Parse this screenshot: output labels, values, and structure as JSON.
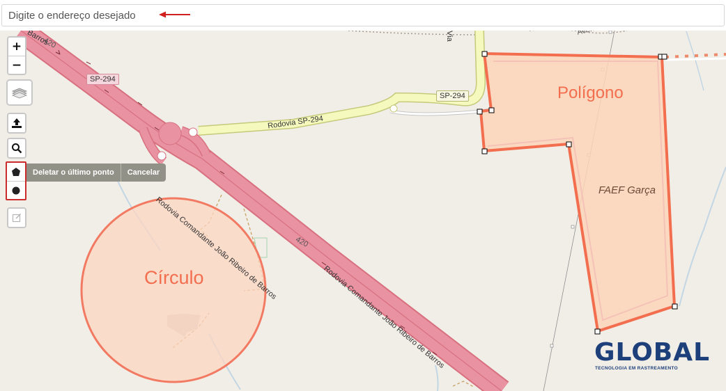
{
  "search": {
    "placeholder": "Digite o endereço desejado"
  },
  "map": {
    "labels": {
      "polygon": "Polígono",
      "circle": "Círculo",
      "area_name": "FAEF Garça"
    },
    "roads": {
      "shield_sp294_a": "SP-294",
      "shield_sp294_b": "SP-294",
      "road_sp294": "Rodovia SP-294",
      "road_main_1": "Rodovia Comandante João Ribeiro de Barros",
      "road_main_2": "Rodovia Comandante João Ribeiro de Barros",
      "ref_420_a": "420",
      "ref_420_b": "420",
      "barros_fragment": "Barros",
      "via_fragment": "Via",
      "avenida_fragment": "Aven"
    }
  },
  "controls": {
    "zoom_in": "+",
    "zoom_out": "−",
    "draw_actions": {
      "delete_last": "Deletar o último ponto",
      "cancel": "Cancelar"
    }
  },
  "logo": {
    "brand": "GLOBAL",
    "tagline": "TECNOLOGIA EM RASTREAMENTO"
  },
  "colors": {
    "highway": "#e892a2",
    "secondary_road": "#f6f9be",
    "shape_stroke": "#f26e4e",
    "shape_fill": "#fdd5b8",
    "highlight_red": "#cc2b2b",
    "brand_blue": "#1d3f7a"
  }
}
